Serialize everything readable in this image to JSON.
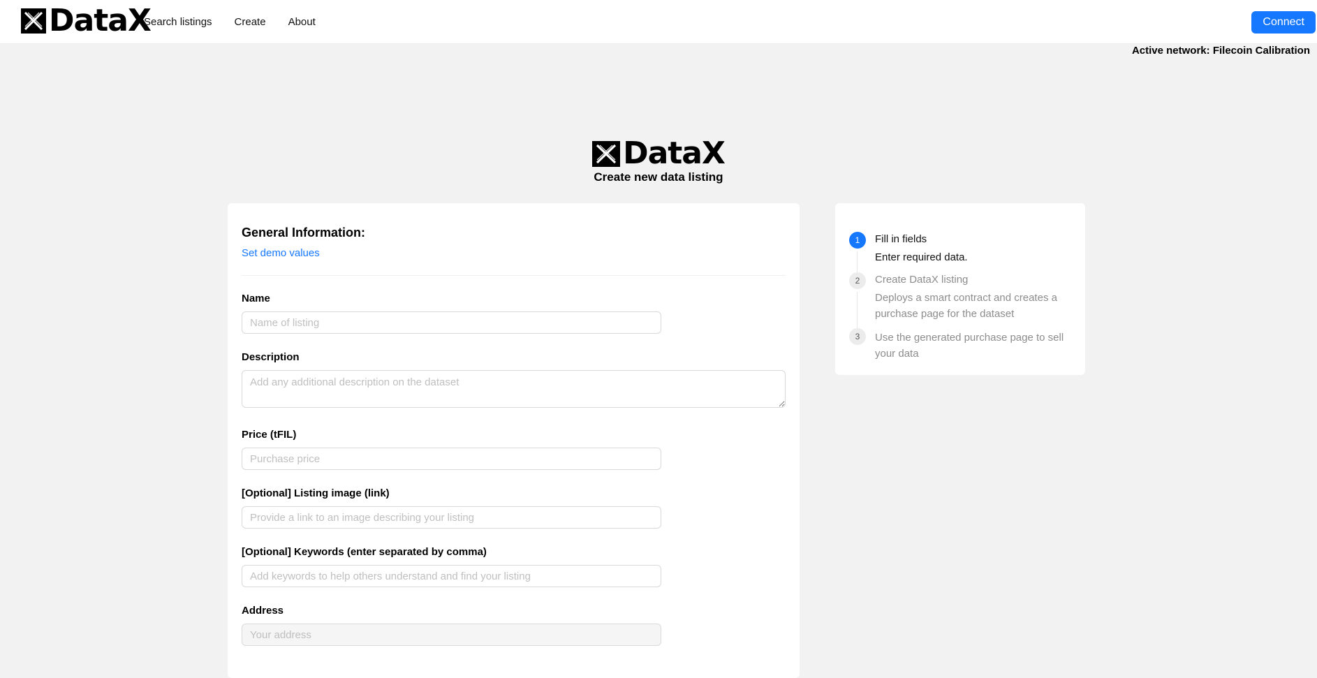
{
  "brand": {
    "name": "DataX",
    "logo_icon": "datax-x-logo-icon"
  },
  "nav": {
    "links": [
      "Search listings",
      "Create",
      "About"
    ],
    "connect_label": "Connect",
    "active_network": "Active network: Filecoin Calibration"
  },
  "hero": {
    "brand_name": "DataX",
    "subtitle": "Create new data listing"
  },
  "form": {
    "section_title": "General Information:",
    "demo_link": "Set demo values",
    "fields": [
      {
        "label": "Name",
        "placeholder": "Name of listing"
      },
      {
        "label": "Description",
        "placeholder": "Add any additional description on the dataset"
      },
      {
        "label": "Price (tFIL)",
        "placeholder": "Purchase price"
      },
      {
        "label": "[Optional] Listing image (link)",
        "placeholder": "Provide a link to an image describing your listing"
      },
      {
        "label": "[Optional] Keywords (enter separated by comma)",
        "placeholder": "Add keywords to help others understand and find your listing"
      },
      {
        "label": "Address",
        "placeholder": "Your address"
      }
    ]
  },
  "steps": [
    {
      "num": "1",
      "title": "Fill in fields",
      "desc": "Enter required data.",
      "state": "active"
    },
    {
      "num": "2",
      "title": "Create DataX listing",
      "desc": "Deploys a smart contract and creates a purchase page for the dataset",
      "state": "wait"
    },
    {
      "num": "3",
      "title": "",
      "desc": "Use the generated purchase page to sell your data",
      "state": "wait"
    }
  ],
  "colors": {
    "accent": "#1677ff",
    "background": "#f2f2f2"
  }
}
